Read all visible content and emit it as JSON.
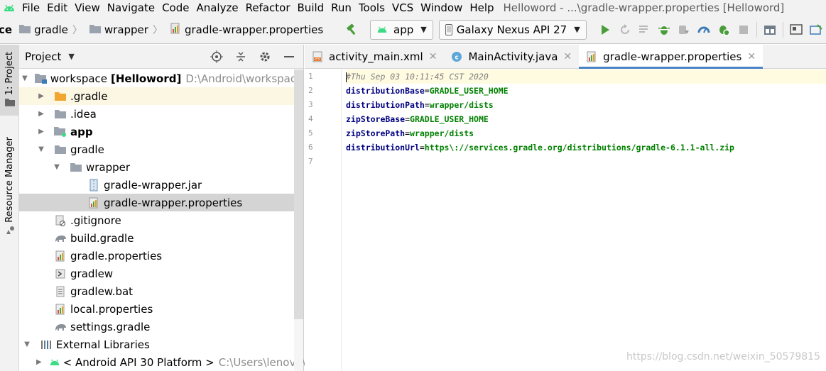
{
  "menubar": {
    "items": [
      "File",
      "Edit",
      "View",
      "Navigate",
      "Code",
      "Analyze",
      "Refactor",
      "Build",
      "Run",
      "Tools",
      "VCS",
      "Window",
      "Help"
    ],
    "window_title": "Helloword - ...\\gradle-wrapper.properties [Helloword]"
  },
  "breadcrumb": {
    "items": [
      "ce",
      "gradle",
      "wrapper",
      "gradle-wrapper.properties"
    ]
  },
  "toolbar": {
    "run_config": "app",
    "device": "Galaxy Nexus API 27"
  },
  "left_stripe": {
    "project_tab": "1: Project",
    "resource_tab": "Resource Manager"
  },
  "project_panel": {
    "title": "Project",
    "tree": [
      {
        "label": "workspace",
        "bold_suffix": "[Helloword]",
        "path": "D:\\Android\\workspace"
      },
      {
        "label": ".gradle"
      },
      {
        "label": ".idea"
      },
      {
        "label": "app"
      },
      {
        "label": "gradle"
      },
      {
        "label": "wrapper"
      },
      {
        "label": "gradle-wrapper.jar"
      },
      {
        "label": "gradle-wrapper.properties"
      },
      {
        "label": ".gitignore"
      },
      {
        "label": "build.gradle"
      },
      {
        "label": "gradle.properties"
      },
      {
        "label": "gradlew"
      },
      {
        "label": "gradlew.bat"
      },
      {
        "label": "local.properties"
      },
      {
        "label": "settings.gradle"
      },
      {
        "label": "External Libraries"
      },
      {
        "label": "< Android API 30 Platform >",
        "path": "C:\\Users\\lenovo\\Ap"
      }
    ]
  },
  "editor": {
    "tabs": [
      {
        "label": "activity_main.xml"
      },
      {
        "label": "MainActivity.java"
      },
      {
        "label": "gradle-wrapper.properties"
      }
    ],
    "line_numbers": [
      "1",
      "2",
      "3",
      "4",
      "5",
      "6",
      "7"
    ],
    "comment": "#Thu Sep 03 10:11:45 CST 2020",
    "props": [
      {
        "key": "distributionBase",
        "value": "GRADLE_USER_HOME"
      },
      {
        "key": "distributionPath",
        "value": "wrapper/dists"
      },
      {
        "key": "zipStoreBase",
        "value": "GRADLE_USER_HOME"
      },
      {
        "key": "zipStorePath",
        "value": "wrapper/dists"
      },
      {
        "key": "distributionUrl",
        "value": "https\\://services.gradle.org/distributions/gradle-6.1.1-all.zip"
      }
    ]
  },
  "watermark": "https://blog.csdn.net/weixin_50579815",
  "colors": {
    "accent": "#4a83c6",
    "keyword": "#000080",
    "value": "#008000",
    "selection": "#d4d4d4",
    "android_green": "#3ddc84"
  }
}
